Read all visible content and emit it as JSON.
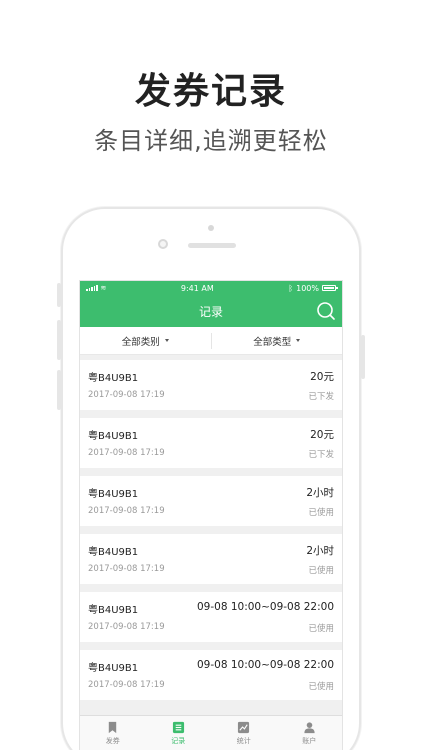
{
  "promo": {
    "title": "发券记录",
    "subtitle": "条目详细,追溯更轻松"
  },
  "status_bar": {
    "time": "9:41 AM",
    "battery": "100%",
    "battery_level": 1.0
  },
  "nav": {
    "title": "记录",
    "search_icon": "search-icon"
  },
  "filters": {
    "category": "全部类别",
    "type": "全部类型"
  },
  "records": [
    {
      "plate": "粤B4U9B1",
      "value": "20元",
      "time": "2017-09-08 17:19",
      "status": "已下发"
    },
    {
      "plate": "粤B4U9B1",
      "value": "20元",
      "time": "2017-09-08 17:19",
      "status": "已下发"
    },
    {
      "plate": "粤B4U9B1",
      "value": "2小时",
      "time": "2017-09-08 17:19",
      "status": "已使用"
    },
    {
      "plate": "粤B4U9B1",
      "value": "2小时",
      "time": "2017-09-08 17:19",
      "status": "已使用"
    },
    {
      "plate": "粤B4U9B1",
      "value": "09-08 10:00~09-08 22:00",
      "time": "2017-09-08 17:19",
      "status": "已使用"
    },
    {
      "plate": "粤B4U9B1",
      "value": "09-08 10:00~09-08 22:00",
      "time": "2017-09-08 17:19",
      "status": "已使用"
    }
  ],
  "tabs": [
    {
      "label": "发券",
      "icon": "bookmark-icon",
      "active": false
    },
    {
      "label": "记录",
      "icon": "list-icon",
      "active": true
    },
    {
      "label": "统计",
      "icon": "chart-icon",
      "active": false
    },
    {
      "label": "账户",
      "icon": "user-icon",
      "active": false
    }
  ],
  "colors": {
    "brand": "#3dbd6e",
    "background": "#f0f0f0",
    "text_secondary": "#9a9a9a"
  }
}
